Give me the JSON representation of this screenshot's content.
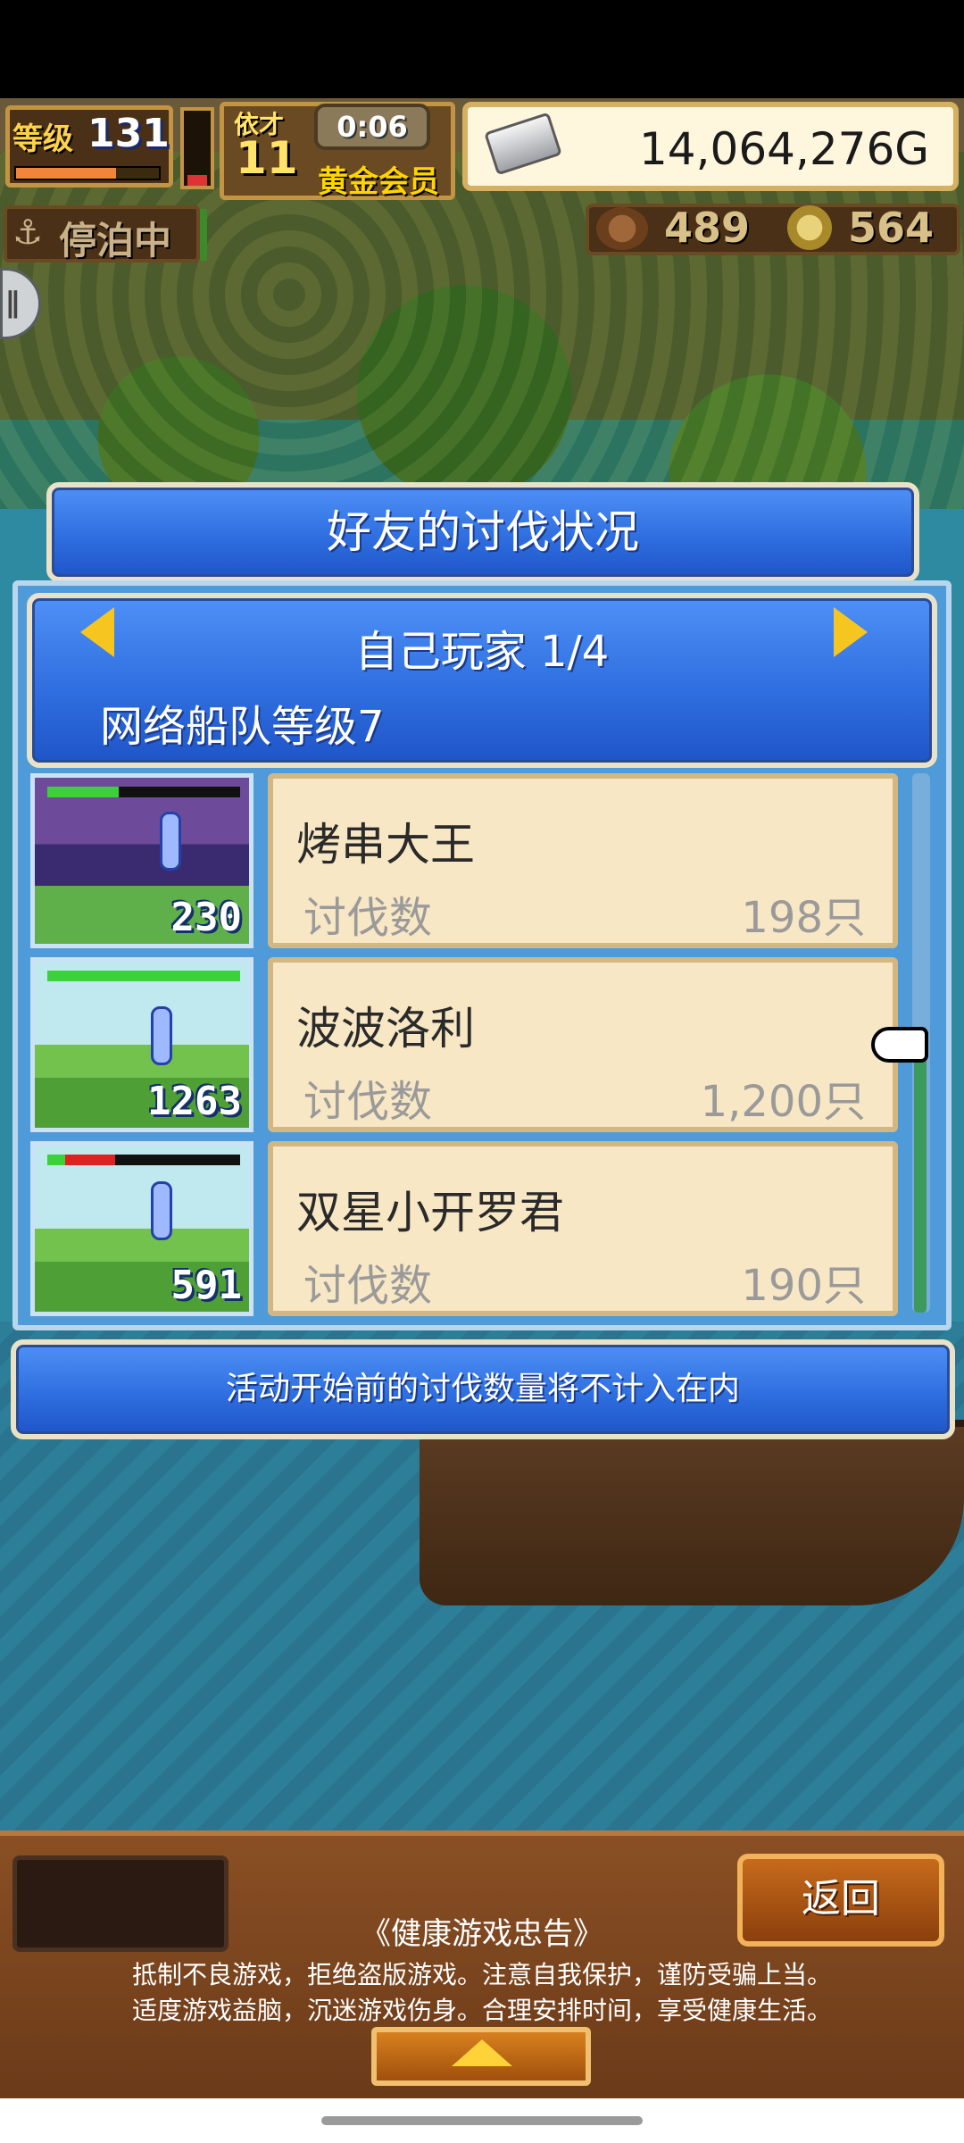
{
  "hud": {
    "level_label": "等级",
    "level_value": "131",
    "level_progress": 0.7,
    "member_top": "依才",
    "member_value": "11",
    "timer": "0:06",
    "member_label": "黄金会员",
    "money": "14,064,276G",
    "mooring_icon": "anchor-icon",
    "mooring_label": "停泊中",
    "resource1_value": "489",
    "resource2_value": "564"
  },
  "dialog": {
    "title": "好友的讨伐状况",
    "player_label": "自己玩家 1/4",
    "fleet_label": "网络船队等级7",
    "notice": "活动开始前的讨伐数量将不计入在内",
    "rows": [
      {
        "name": "烤串大王",
        "count_label": "讨伐数",
        "count_value": "198只",
        "thumb_level": "230"
      },
      {
        "name": "波波洛利",
        "count_label": "讨伐数",
        "count_value": "1,200只",
        "thumb_level": "1263"
      },
      {
        "name": "双星小开罗君",
        "count_label": "讨伐数",
        "count_value": "190只",
        "thumb_level": "591"
      }
    ]
  },
  "bottom": {
    "back_label": "返回",
    "health_title": "《健康游戏忠告》",
    "health_line1": "抵制不良游戏，拒绝盗版游戏。注意自我保护，谨防受骗上当。",
    "health_line2": "适度游戏益脑，沉迷游戏伤身。合理安排时间，享受健康生活。"
  },
  "colors": {
    "panel_blue": "#2f6fe0",
    "card_beige": "#f8e7c4",
    "gold": "#f6c51f"
  }
}
